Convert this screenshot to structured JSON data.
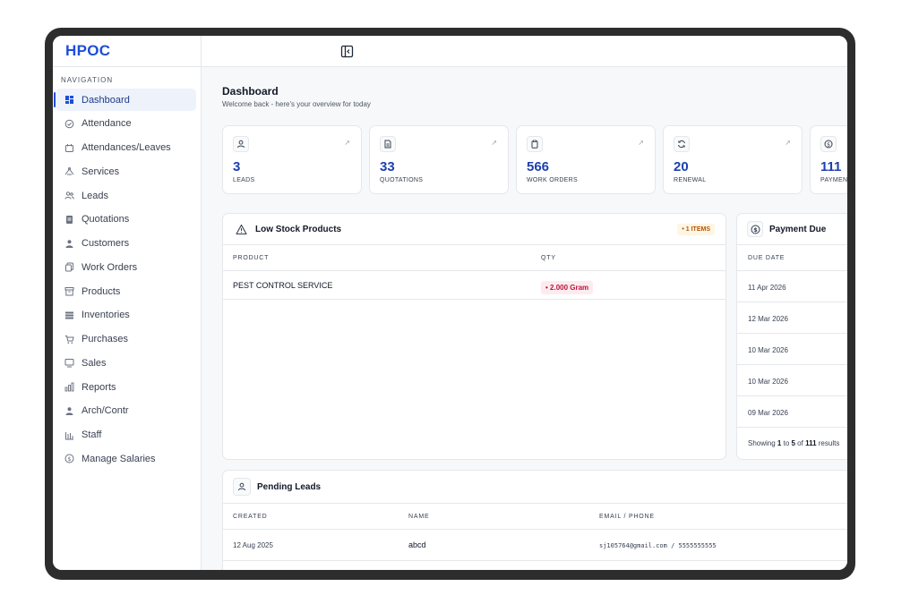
{
  "brand": "HPOC",
  "nav_heading": "NAVIGATION",
  "nav": [
    {
      "label": "Dashboard",
      "icon": "dashboard-icon"
    },
    {
      "label": "Attendance",
      "icon": "check-circle-icon"
    },
    {
      "label": "Attendances/Leaves",
      "icon": "calendar-icon"
    },
    {
      "label": "Services",
      "icon": "services-icon"
    },
    {
      "label": "Leads",
      "icon": "users-icon"
    },
    {
      "label": "Quotations",
      "icon": "document-icon"
    },
    {
      "label": "Customers",
      "icon": "user-icon"
    },
    {
      "label": "Work Orders",
      "icon": "copy-icon"
    },
    {
      "label": "Products",
      "icon": "archive-icon"
    },
    {
      "label": "Inventories",
      "icon": "list-icon"
    },
    {
      "label": "Purchases",
      "icon": "cart-icon"
    },
    {
      "label": "Sales",
      "icon": "monitor-icon"
    },
    {
      "label": "Reports",
      "icon": "bar-chart-icon"
    },
    {
      "label": "Arch/Contr",
      "icon": "user-icon"
    },
    {
      "label": "Staff",
      "icon": "staff-chart-icon"
    },
    {
      "label": "Manage Salaries",
      "icon": "dollar-circle-icon"
    }
  ],
  "page": {
    "title": "Dashboard",
    "subtitle": "Welcome back - here's your overview for today"
  },
  "stats": [
    {
      "value": "3",
      "label": "LEADS"
    },
    {
      "value": "33",
      "label": "QUOTATIONS"
    },
    {
      "value": "566",
      "label": "WORK ORDERS"
    },
    {
      "value": "20",
      "label": "RENEWAL"
    },
    {
      "value": "111",
      "label": "PAYMENTS"
    }
  ],
  "stat_arrow": "↗",
  "low_stock": {
    "title": "Low Stock Products",
    "badge": "• 1 ITEMS",
    "col_product": "PRODUCT",
    "col_qty": "QTY",
    "rows": [
      {
        "product": "PEST CONTROL SERVICE",
        "qty": "• 2.000 Gram"
      }
    ]
  },
  "payment_due": {
    "title": "Payment Due",
    "col_due": "DUE DATE",
    "rows": [
      "11 Apr 2026",
      "12 Mar 2026",
      "10 Mar 2026",
      "10 Mar 2026",
      "09 Mar 2026"
    ],
    "footer_prefix": "Showing ",
    "footer_from": "1",
    "footer_to_word": " to ",
    "footer_to": "5",
    "footer_of_word": " of ",
    "footer_total": "111",
    "footer_suffix": " results"
  },
  "pending_leads": {
    "title": "Pending Leads",
    "col_created": "CREATED",
    "col_name": "NAME",
    "col_contact": "EMAIL / PHONE",
    "rows": [
      {
        "created": "12 Aug 2025",
        "name": "abcd",
        "contact": "sj105764@gmail.com / 5555555555"
      }
    ]
  },
  "colors": {
    "accent": "#1d4ed8",
    "value_blue": "#1e40af",
    "qty_red": "#be123c",
    "badge_amber": "#b45309"
  }
}
